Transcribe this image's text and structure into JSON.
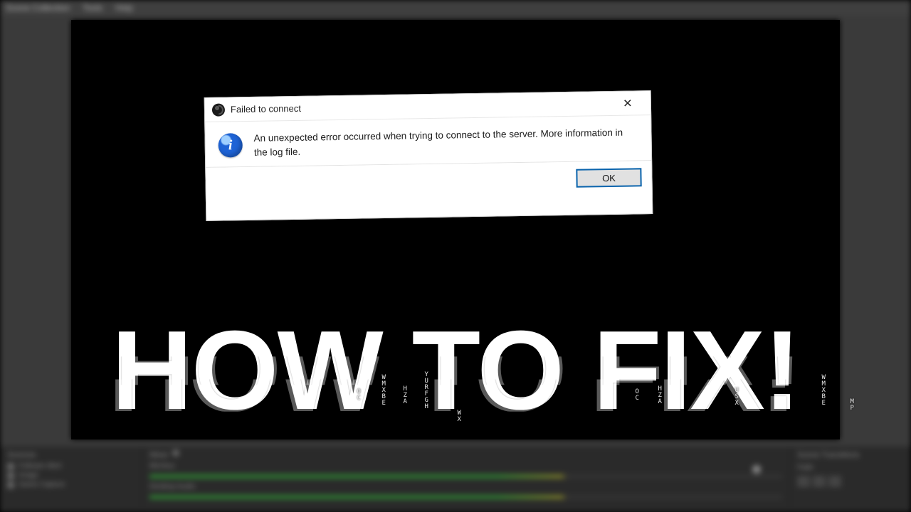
{
  "menubar": {
    "items": [
      "Scene Collection",
      "Tools",
      "Help"
    ]
  },
  "dialog": {
    "title": "Failed to connect",
    "message": "An unexpected error occurred when trying to connect to the server.  More information in the log file.",
    "ok_label": "OK",
    "close_symbol": "✕"
  },
  "overlay": {
    "headline": "HOW TO FIX!"
  },
  "panels": {
    "sources_title": "Sources",
    "mixer_title": "Mixer",
    "transitions_title": "Scene Transitions",
    "mixer_track1": "Mic/Aux",
    "mixer_track2": "Desktop Audio",
    "transition_mode": "Fade",
    "sources": [
      "Follower Alert",
      "Image",
      "Game Capture"
    ]
  }
}
